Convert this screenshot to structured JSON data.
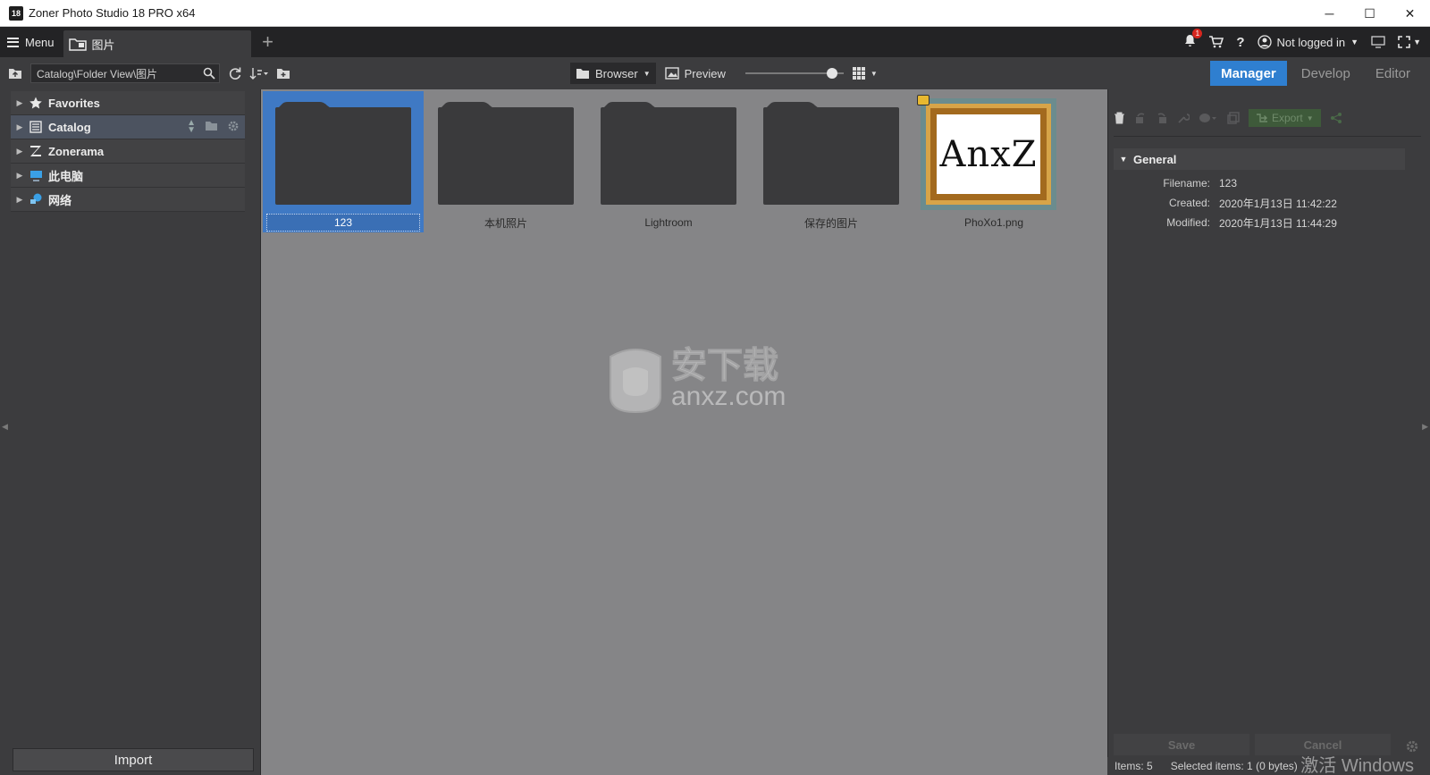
{
  "window": {
    "title": "Zoner Photo Studio 18 PRO x64",
    "app_icon_text": "18",
    "minimize": "─",
    "maximize": "☐",
    "close": "✕"
  },
  "tabbar": {
    "menu_label": "Menu",
    "doc_tab_label": "图片",
    "add_tab": "+",
    "notification_count": "1",
    "help": "?",
    "login_label": "Not logged in"
  },
  "toolbar": {
    "path": "Catalog\\Folder View\\图片",
    "browser_label": "Browser",
    "preview_label": "Preview",
    "zoom_level": 0.93,
    "modes": [
      {
        "label": "Manager",
        "active": true
      },
      {
        "label": "Develop",
        "active": false
      },
      {
        "label": "Editor",
        "active": false
      }
    ]
  },
  "navigator": {
    "items": [
      {
        "label": "Favorites",
        "icon": "star-icon"
      },
      {
        "label": "Catalog",
        "icon": "catalog-icon",
        "selected": true
      },
      {
        "label": "Zonerama",
        "icon": "zonerama-icon"
      },
      {
        "label": "此电脑",
        "icon": "computer-icon"
      },
      {
        "label": "网络",
        "icon": "network-icon"
      }
    ],
    "import_label": "Import"
  },
  "browser": {
    "items": [
      {
        "label": "123",
        "type": "folder",
        "selected": true
      },
      {
        "label": "本机照片",
        "type": "folder"
      },
      {
        "label": "Lightroom",
        "type": "folder"
      },
      {
        "label": "保存的图片",
        "type": "folder"
      },
      {
        "label": "PhoXo1.png",
        "type": "image",
        "image_text": "AnxZ"
      }
    ],
    "watermark_cn": "安下载",
    "watermark_en": "anxz.com"
  },
  "info_panel": {
    "export_label": "Export",
    "section_title": "General",
    "properties": [
      {
        "key": "Filename:",
        "value": "123"
      },
      {
        "key": "Created:",
        "value": "2020年1月13日 11:42:22"
      },
      {
        "key": "Modified:",
        "value": "2020年1月13日 11:44:29"
      }
    ],
    "save_label": "Save",
    "cancel_label": "Cancel"
  },
  "statusbar": {
    "items_count": "Items: 5",
    "selected": "Selected items: 1 (0 bytes)",
    "activate_windows": "激活 Windows"
  },
  "colors": {
    "accent": "#2f7fd0",
    "selection": "#3f79c4",
    "browser_bg": "#858587",
    "panel_bg": "#3c3c3e"
  }
}
